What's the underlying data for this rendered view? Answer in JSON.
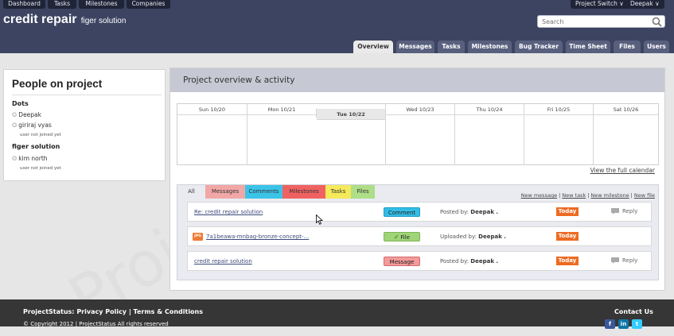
{
  "top_nav": {
    "items": [
      {
        "label": "Dashboard"
      },
      {
        "label": "Tasks"
      },
      {
        "label": "Milestones"
      },
      {
        "label": "Companies"
      }
    ],
    "project_switch": "Project Switch",
    "user": "Deepak"
  },
  "app": {
    "title": "credit repair",
    "subtitle": "figer solution"
  },
  "search": {
    "placeholder": "Search"
  },
  "tabs": [
    {
      "label": "Overview",
      "active": true
    },
    {
      "label": "Messages"
    },
    {
      "label": "Tasks"
    },
    {
      "label": "Milestones"
    },
    {
      "label": "Bug Tracker"
    },
    {
      "label": "Time Sheet"
    },
    {
      "label": "Files"
    },
    {
      "label": "Users"
    }
  ],
  "people": {
    "title": "People on project",
    "groups": [
      {
        "company": "Dots",
        "members": [
          {
            "name": "Deepak",
            "note": ""
          },
          {
            "name": "giriraj vyas",
            "note": "user not joined yet"
          }
        ]
      },
      {
        "company": "figer solution",
        "members": [
          {
            "name": "kim north",
            "note": "user not joined yet"
          }
        ]
      }
    ]
  },
  "overview": {
    "title": "Project overview & activity",
    "calendar_days": [
      "Sun 10/20",
      "Mon 10/21",
      "Tue 10/22",
      "Wed 10/23",
      "Thu 10/24",
      "Fri 10/25",
      "Sat 10/26"
    ],
    "today_index": 2,
    "full_calendar_link": "View the full calendar"
  },
  "activity": {
    "filters": [
      {
        "label": "All",
        "color": "#e9ebf0"
      },
      {
        "label": "Messages",
        "color": "#f2a7a7"
      },
      {
        "label": "Comments",
        "color": "#3cc3e8"
      },
      {
        "label": "Milestones",
        "color": "#f06262"
      },
      {
        "label": "Tasks",
        "color": "#f4ea5a"
      },
      {
        "label": "Files",
        "color": "#aede88"
      }
    ],
    "new_links": [
      "New message",
      "New task",
      "New milestone",
      "New file"
    ],
    "items": [
      {
        "title": "Re: credit repair solution",
        "type": "Comment",
        "color": "#33bde6",
        "action": "Posted by:",
        "user": "Deepak .",
        "day": "Today",
        "reply": "Reply"
      },
      {
        "title": "7a1beawa-mnbag-bronze-concept-...",
        "type": "File",
        "color": "#9fd477",
        "action": "Uploaded by:",
        "user": "Deepak .",
        "day": "Today",
        "reply": "",
        "file_ext": "JPG"
      },
      {
        "title": "credit repair solution",
        "type": "Message",
        "color": "#f49a9a",
        "action": "Posted by:",
        "user": "Deepak .",
        "day": "Today",
        "reply": "Reply"
      }
    ]
  },
  "footer": {
    "brand": "ProjectStatus:",
    "privacy": "Privacy Policy",
    "separator": "|",
    "terms": "Terms & Conditions",
    "copyright": "© Copyright 2012 | ProjectStatus All rights reserved",
    "contact": "Contact Us"
  },
  "watermark": "ProjectStatus",
  "colors": {
    "header": "#3c4461",
    "today_badge": "#ed6a22",
    "footer": "#363636"
  }
}
